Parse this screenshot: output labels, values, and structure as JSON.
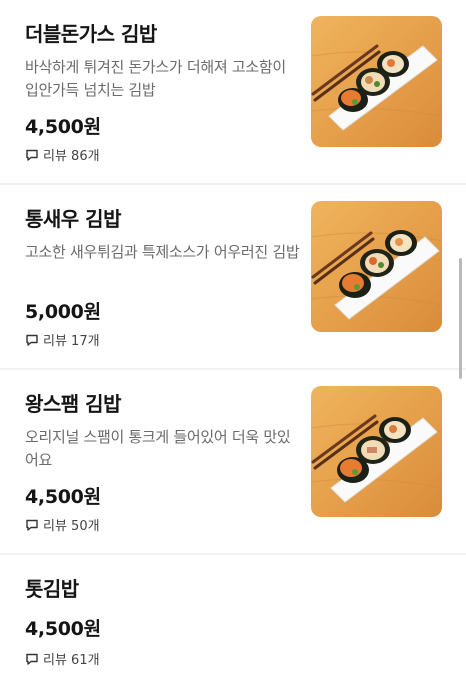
{
  "menu": {
    "items": [
      {
        "name": "더블돈가스 김밥",
        "description": "바삭하게 튀겨진 돈가스가 더해져 고소함이 입안가득 넘치는 김밥",
        "price": "4,500원",
        "review": "리뷰 86개",
        "image_icon": "kimbap-photo"
      },
      {
        "name": "통새우 김밥",
        "description": "고소한 새우튀김과 특제소스가 어우러진 김밥",
        "price": "5,000원",
        "review": "리뷰 17개",
        "image_icon": "kimbap-photo"
      },
      {
        "name": "왕스팸 김밥",
        "description": "오리지널 스팸이 통크게 들어있어 더욱 맛있어요",
        "price": "4,500원",
        "review": "리뷰 50개",
        "image_icon": "kimbap-photo"
      },
      {
        "name": "톳김밥",
        "price": "4,500원",
        "review": "리뷰 61개"
      }
    ]
  },
  "colors": {
    "background": "#ffffff",
    "title": "#151515",
    "description": "#6b6b6b",
    "divider": "#f1f1f1",
    "image_wood": "#e9a24c"
  },
  "icons": {
    "review": "speech-bubble-icon"
  }
}
